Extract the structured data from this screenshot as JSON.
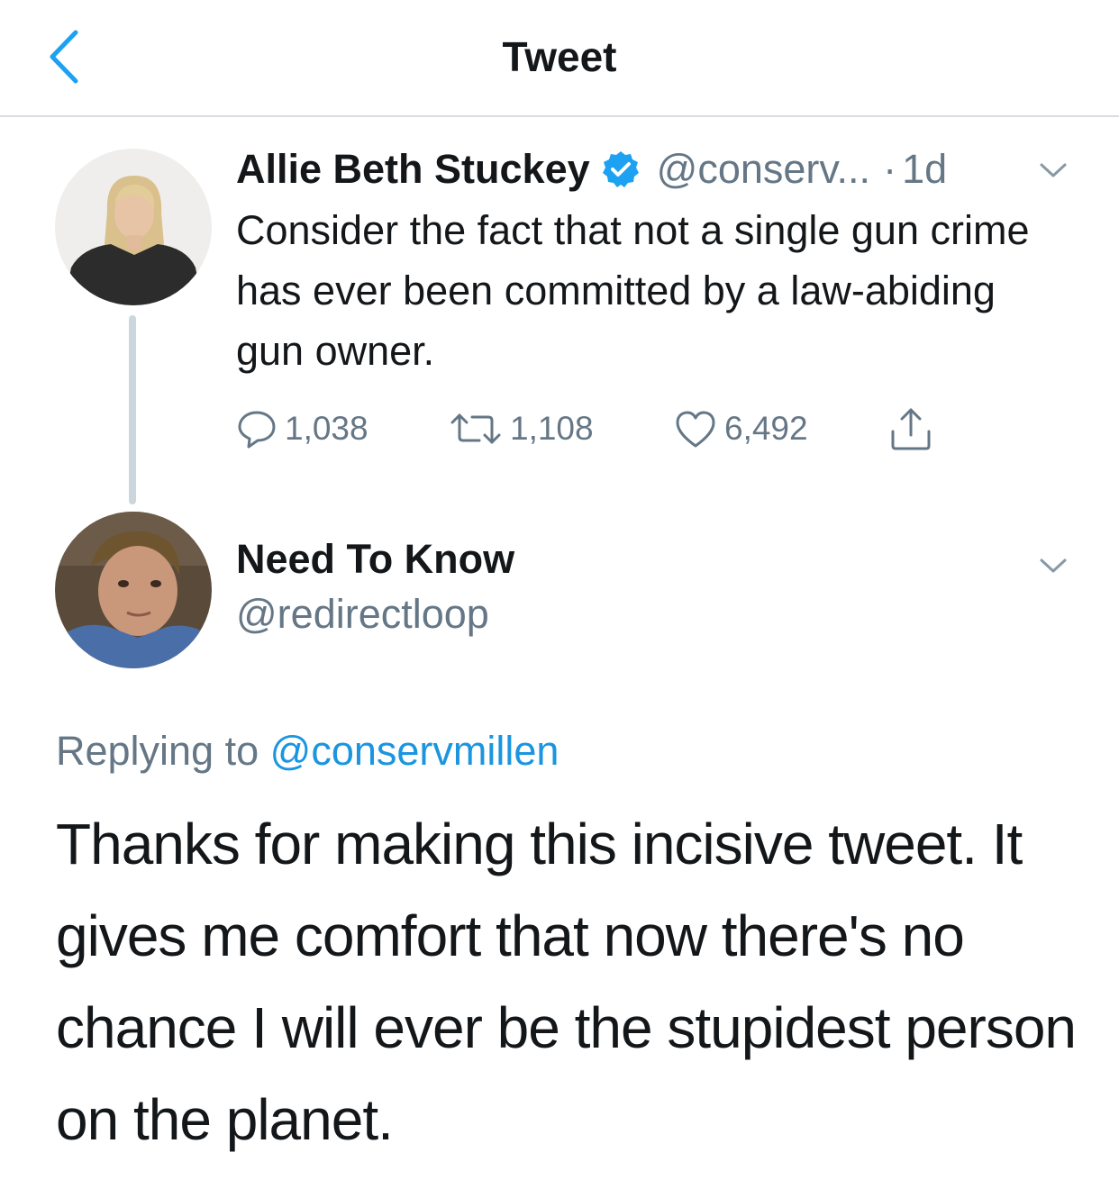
{
  "header": {
    "title": "Tweet",
    "back_icon": "chevron-left-icon"
  },
  "colors": {
    "accent": "#1da1f2",
    "link": "#1b95e0",
    "secondary_text": "#657786",
    "primary_text": "#14171a",
    "divider": "#d9dde1"
  },
  "original_tweet": {
    "display_name": "Allie Beth Stuckey",
    "verified": true,
    "handle": "@conserv...",
    "separator": "·",
    "time": "1d",
    "text": "Consider the fact that not a single gun crime has ever been committed by a law-abiding gun owner.",
    "stats": {
      "replies": "1,038",
      "retweets": "1,108",
      "likes": "6,492"
    }
  },
  "reply": {
    "display_name": "Need To Know",
    "handle": "@redirectloop",
    "replying_prefix": "Replying to",
    "replying_to": "@conservmillen",
    "text": "Thanks for making this incisive tweet. It gives me comfort that now there's no chance I will ever be the stupidest person on the planet."
  }
}
